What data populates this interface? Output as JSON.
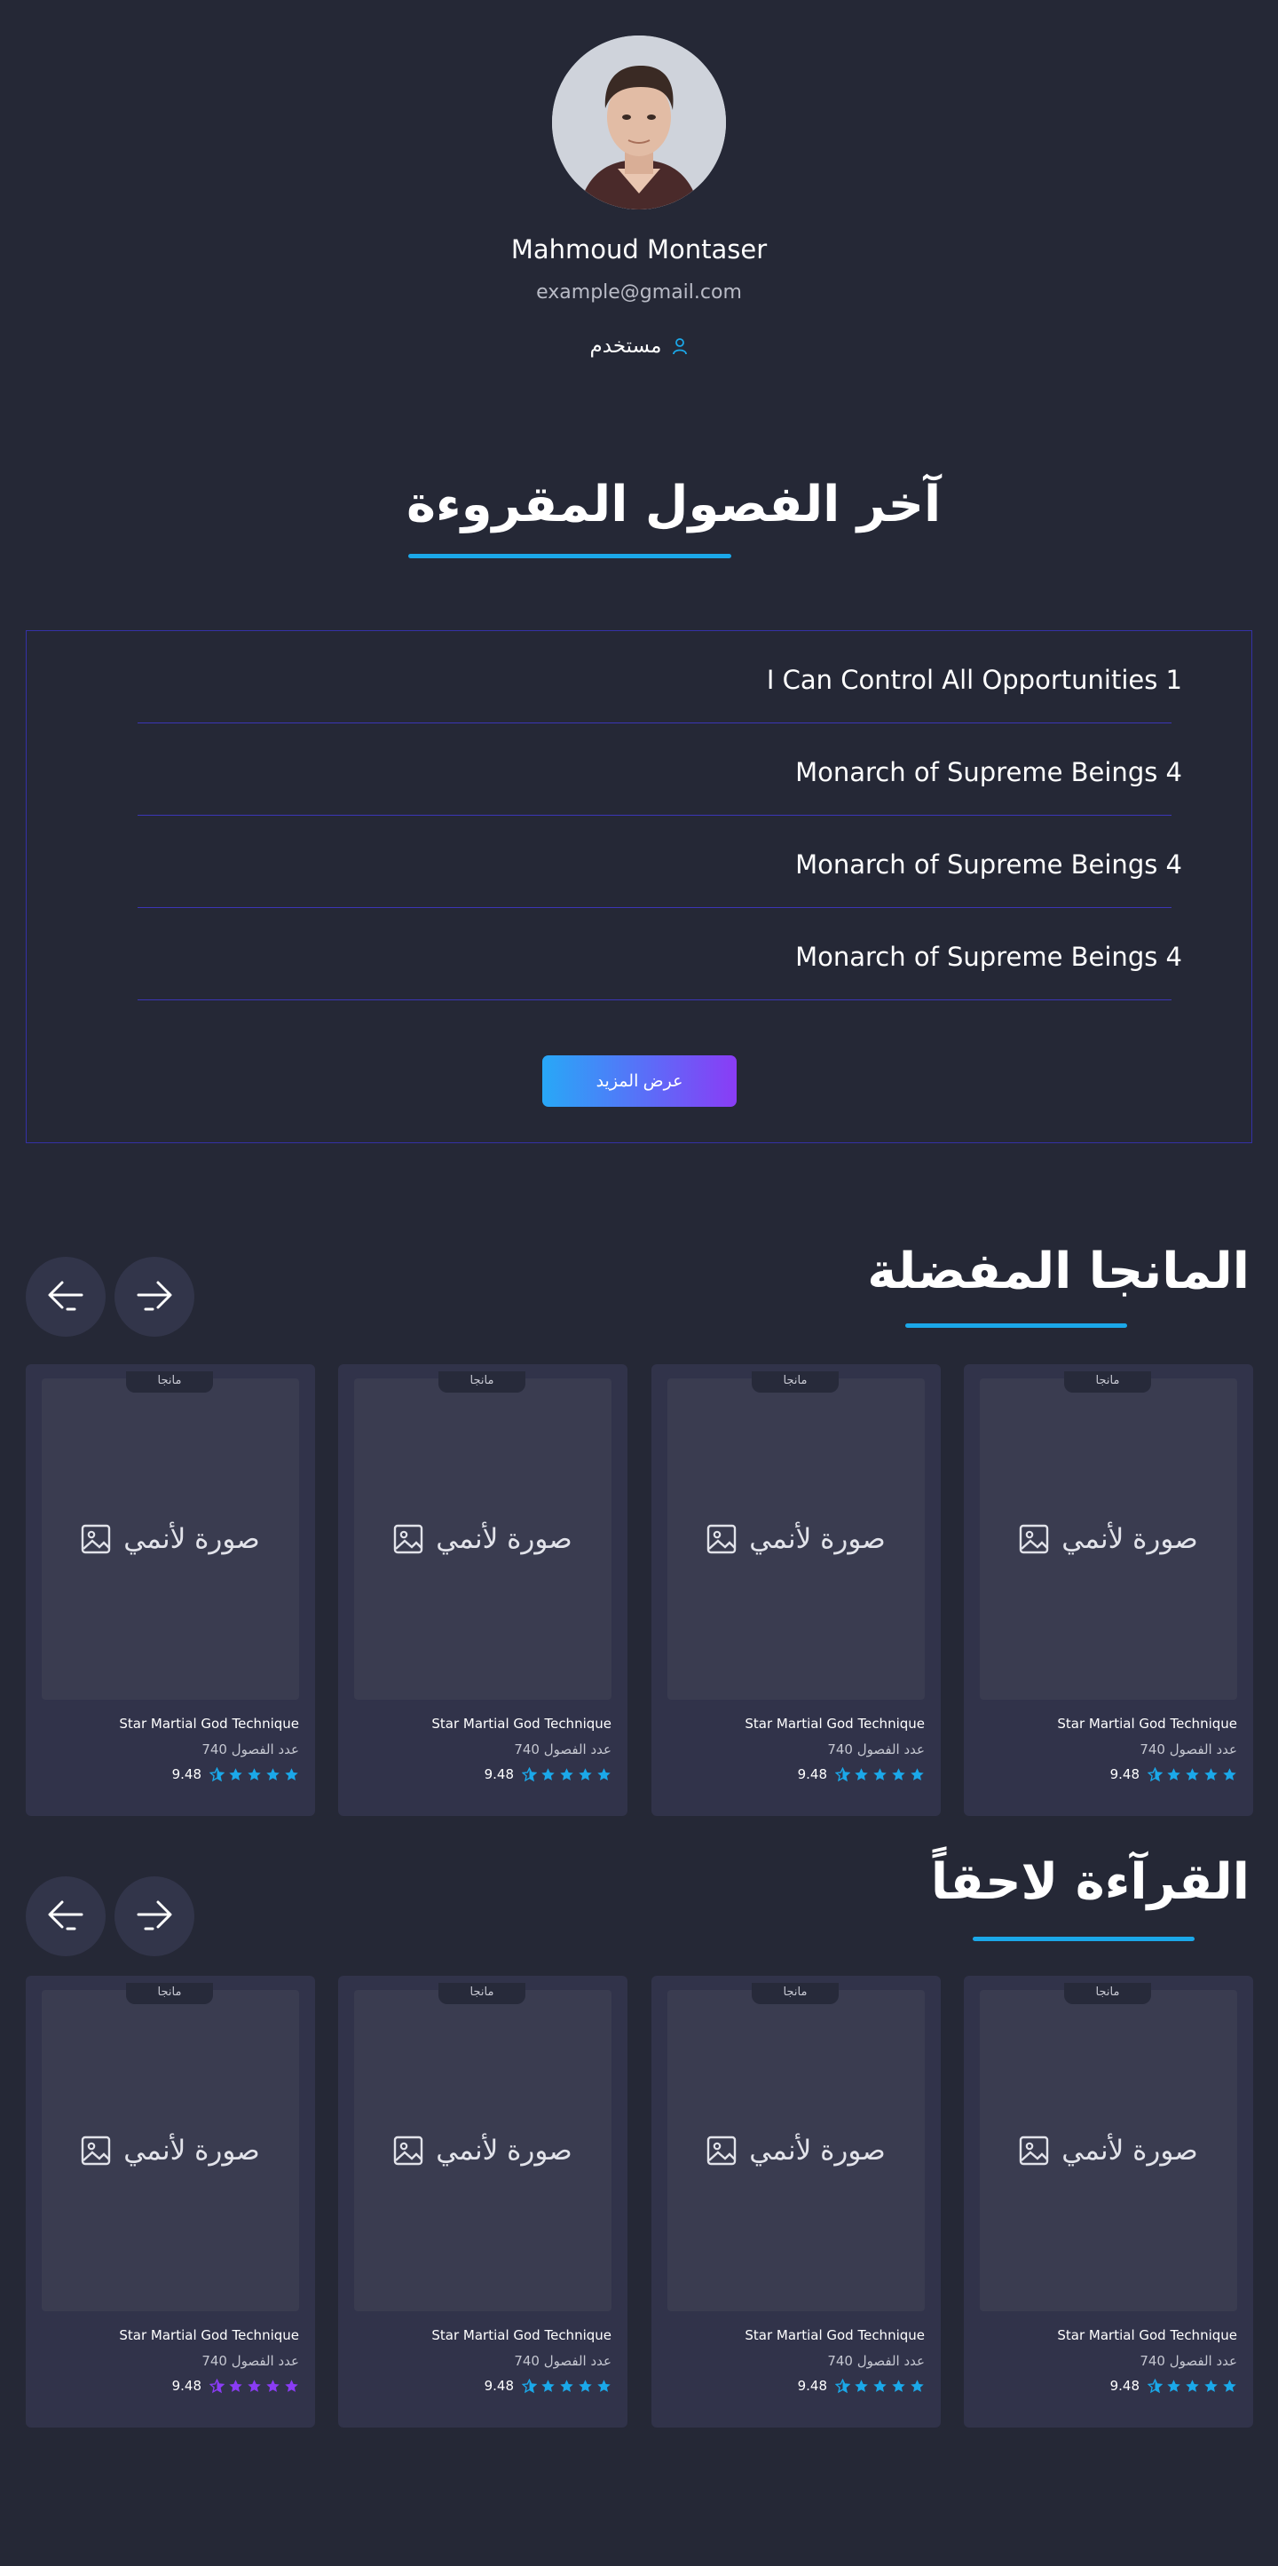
{
  "profile": {
    "name": "Mahmoud Montaser",
    "email": "example@gmail.com",
    "role": "مستخدم"
  },
  "latest": {
    "title": "آخر الفصول المقروءة",
    "chapters": [
      "I Can Control All Opportunities 1",
      "Monarch of Supreme Beings 4",
      "Monarch of Supreme Beings 4",
      "Monarch of Supreme Beings 4"
    ],
    "more_label": "عرض المزيد"
  },
  "favorites": {
    "title": "المانجا المفضلة",
    "cards": [
      {
        "tag": "مانجا",
        "placeholder": "صورة لأنمي",
        "title": "Star Martial God Technique",
        "chapters": "عدد الفصول 740",
        "score": "9.48",
        "stars": 4.5,
        "star_color": "#1ba8e9"
      },
      {
        "tag": "مانجا",
        "placeholder": "صورة لأنمي",
        "title": "Star Martial God Technique",
        "chapters": "عدد الفصول 740",
        "score": "9.48",
        "stars": 4.5,
        "star_color": "#1ba8e9"
      },
      {
        "tag": "مانجا",
        "placeholder": "صورة لأنمي",
        "title": "Star Martial God Technique",
        "chapters": "عدد الفصول 740",
        "score": "9.48",
        "stars": 4.5,
        "star_color": "#1ba8e9"
      },
      {
        "tag": "مانجا",
        "placeholder": "صورة لأنمي",
        "title": "Star Martial God Technique",
        "chapters": "عدد الفصول 740",
        "score": "9.48",
        "stars": 4.5,
        "star_color": "#1ba8e9"
      }
    ]
  },
  "later": {
    "title": "القرآءة لاحقاً",
    "cards": [
      {
        "tag": "مانجا",
        "placeholder": "صورة لأنمي",
        "title": "Star Martial God Technique",
        "chapters": "عدد الفصول 740",
        "score": "9.48",
        "stars": 4.5,
        "star_color": "#8a3cf5"
      },
      {
        "tag": "مانجا",
        "placeholder": "صورة لأنمي",
        "title": "Star Martial God Technique",
        "chapters": "عدد الفصول 740",
        "score": "9.48",
        "stars": 4.5,
        "star_color": "#1ba8e9"
      },
      {
        "tag": "مانجا",
        "placeholder": "صورة لأنمي",
        "title": "Star Martial God Technique",
        "chapters": "عدد الفصول 740",
        "score": "9.48",
        "stars": 4.5,
        "star_color": "#1ba8e9"
      },
      {
        "tag": "مانجا",
        "placeholder": "صورة لأنمي",
        "title": "Star Martial God Technique",
        "chapters": "عدد الفصول 740",
        "score": "9.48",
        "stars": 4.5,
        "star_color": "#1ba8e9"
      }
    ]
  },
  "colors": {
    "background": "#252836",
    "card": "#31334a",
    "accent_blue": "#1ba8e9",
    "accent_purple": "#8a3cf5",
    "chapter_border": "#3531a6"
  },
  "icons": {
    "role": "user-icon",
    "prev": "arrow-left-icon",
    "next": "arrow-right-icon",
    "placeholder": "image-icon",
    "rating": "star-icon"
  }
}
